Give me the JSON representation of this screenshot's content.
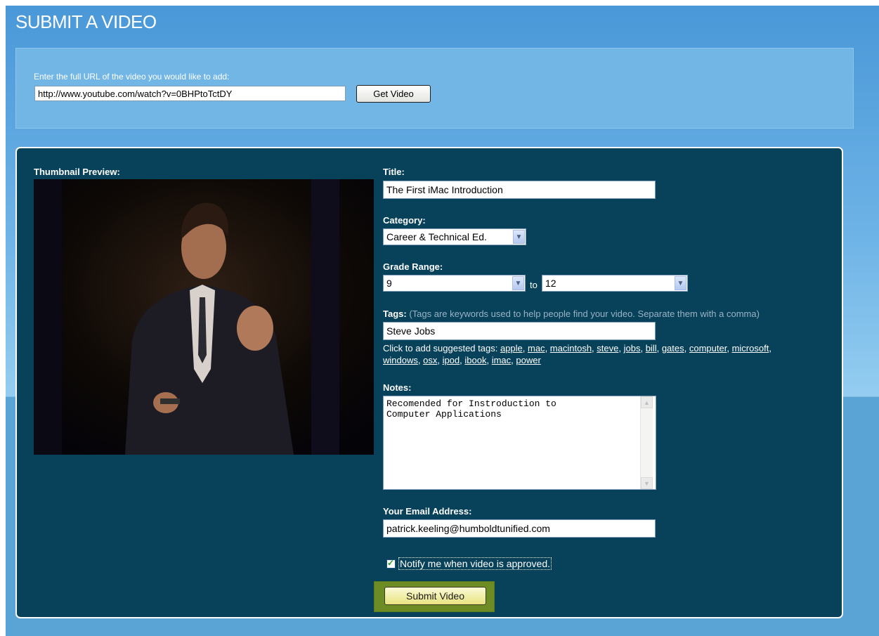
{
  "page": {
    "title": "SUBMIT A VIDEO"
  },
  "url_section": {
    "label": "Enter the full URL of the video you would like to add:",
    "url_value": "http://www.youtube.com/watch?v=0BHPtoTctDY",
    "get_button": "Get Video"
  },
  "form": {
    "thumbnail_label": "Thumbnail Preview:",
    "title_label": "Title:",
    "title_value": "The First iMac Introduction",
    "category_label": "Category:",
    "category_value": "Career & Technical Ed.",
    "grade_label": "Grade Range:",
    "grade_from": "9",
    "grade_to_word": "to",
    "grade_to": "12",
    "tags_label": "Tags:",
    "tags_hint": "(Tags are keywords used to help people find your video. Separate them with a comma)",
    "tags_value": "Steve Jobs",
    "suggest_prefix": "Click to add suggested tags:",
    "suggested_tags": [
      "apple",
      "mac",
      "macintosh",
      "steve",
      "jobs",
      "bill",
      "gates",
      "computer",
      "microsoft",
      "windows",
      "osx",
      "ipod",
      "ibook",
      "imac",
      "power"
    ],
    "notes_label": "Notes:",
    "notes_value": "Recomended for Instroduction to\nComputer Applications",
    "email_label": "Your Email Address:",
    "email_value": "patrick.keeling@humboldtunified.com",
    "notify_label": "Notify me when video is approved.",
    "notify_checked": true,
    "submit_button": "Submit Video"
  },
  "colors": {
    "page_background": "#5aa3d5",
    "panel_background": "#07415a",
    "submit_highlight": "#6d8c23"
  }
}
